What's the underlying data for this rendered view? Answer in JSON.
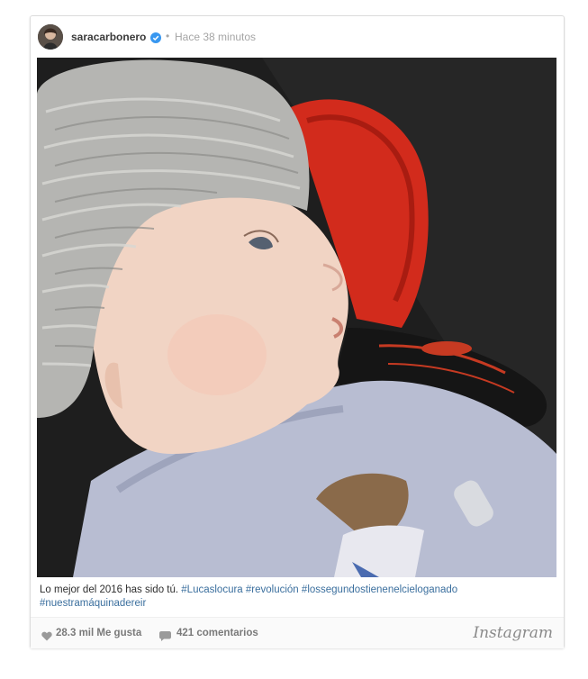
{
  "post": {
    "username": "saracarbonero",
    "separator": "•",
    "time": "Hace 38 minutos",
    "caption_text": "Lo mejor del 2016 has sido tú. ",
    "hashtags": [
      "#Lucaslocura",
      "#revolución",
      "#lossegundostienenelcieloganado",
      "#nuestramáquinadereir"
    ],
    "likes": "28.3 mil Me gusta",
    "comments": "421 comentarios",
    "brand": "Instagram"
  },
  "colors": {
    "hashtag": "#3b6f9e",
    "verified": "#3897f0",
    "footer_bg": "#fafafa"
  },
  "icons": {
    "verified": "verified-badge-icon",
    "like": "heart-icon",
    "comment": "comment-bubble-icon"
  }
}
